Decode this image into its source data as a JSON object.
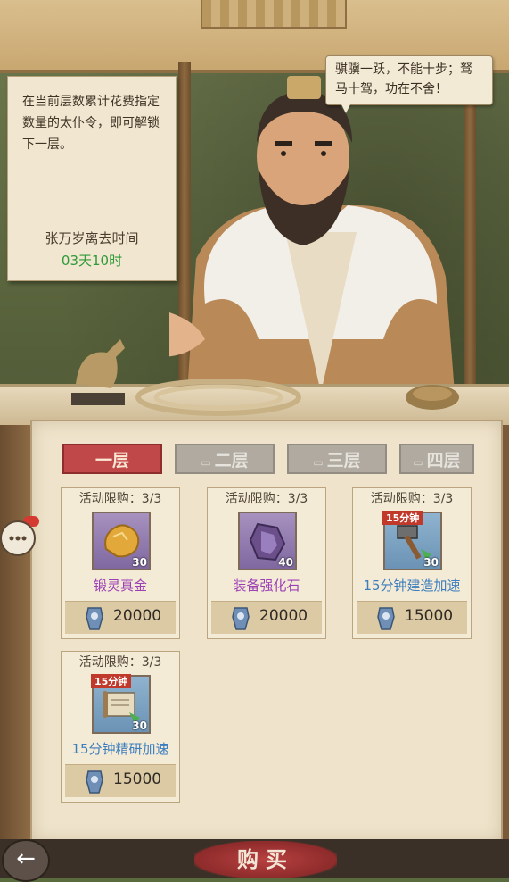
{
  "note": {
    "description": "在当前层数累计花费指定数量的太仆令，即可解锁下一层。",
    "timer_label": "张万岁离去时间",
    "timer_value": "03天10时"
  },
  "speech": "骐骥一跃，不能十步；驽马十驾，功在不舍！",
  "tabs": [
    {
      "label": "一层",
      "active": true
    },
    {
      "label": "二层",
      "active": false
    },
    {
      "label": "三层",
      "active": false
    },
    {
      "label": "四层",
      "active": false
    }
  ],
  "items": [
    {
      "limit": "活动限购：3/3",
      "name": "锻灵真金",
      "qty": "30",
      "price": "20000",
      "name_color": "purple"
    },
    {
      "limit": "活动限购：3/3",
      "name": "装备强化石",
      "qty": "40",
      "price": "20000",
      "name_color": "purple"
    },
    {
      "limit": "活动限购：3/3",
      "name": "15分钟建造加速",
      "qty": "30",
      "price": "15000",
      "ribbon": "15分钟",
      "name_color": "blue"
    },
    {
      "limit": "活动限购：3/3",
      "name": "15分钟精研加速",
      "qty": "30",
      "price": "15000",
      "ribbon": "15分钟",
      "name_color": "blue"
    }
  ],
  "buttons": {
    "buy": "购买",
    "back": "←"
  },
  "icons": {
    "back": "back-arrow-icon",
    "chat": "chat-icon",
    "currency": "taipu-token-icon",
    "lock": "lock-icon"
  },
  "colors": {
    "active_tab": "#c04848",
    "locked_tab": "#b0aaa0",
    "purple_item": "#9b3fb5",
    "blue_item": "#3b7dbd",
    "timer": "#2e9a39"
  }
}
